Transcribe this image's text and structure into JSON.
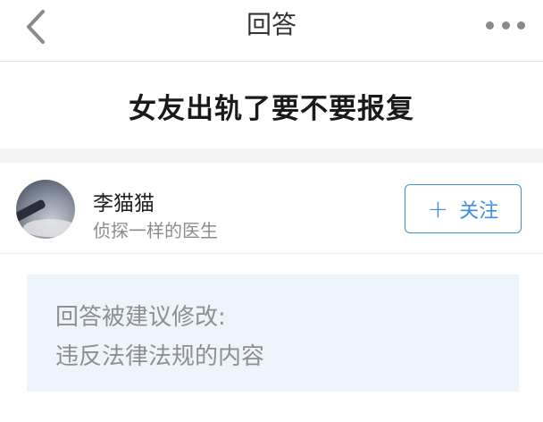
{
  "nav": {
    "title": "回答",
    "back_icon": "chevron-left-icon",
    "more_icon": "more-horizontal-icon"
  },
  "question": {
    "title": "女友出轨了要不要报复"
  },
  "author": {
    "name": "李猫猫",
    "bio": "侦探一样的医生",
    "follow_label": "关注",
    "follow_icon": "plus-icon",
    "accent_color": "#3e8ee0"
  },
  "notice": {
    "line1": "回答被建议修改:",
    "line2": "违反法律法规的内容",
    "background_color": "#edf4fc"
  }
}
